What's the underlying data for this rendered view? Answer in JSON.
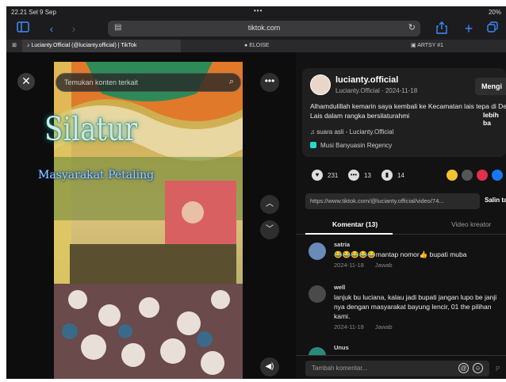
{
  "status": {
    "time": "22.21  Sel 9 Sep",
    "dots": "•••",
    "battery": "20%"
  },
  "browser": {
    "url": "tiktok.com"
  },
  "tabs": [
    {
      "label": "Lucianty.Official (@lucianty.official) | TikTok",
      "active": true
    },
    {
      "label": "ELOISE",
      "active": false
    },
    {
      "label": "ARTSY #1",
      "active": false
    }
  ],
  "video": {
    "search_placeholder": "Temukan konten terkait",
    "overlay_title": "Silatur",
    "overlay_subtitle": "Masyarakat Petaling"
  },
  "post": {
    "username": "lucianty.official",
    "meta": "Lucianty.Official · 2024-11-18",
    "follow_label": "Mengi",
    "caption": "Alhamdulillah kemarin saya kembali ke Kecamatan lais tepa di Desa Lais dalam rangka bersilaturahmi",
    "more_label": "lebih ba",
    "music": "suara asli - Lucianty.Official",
    "location": "Musi Banyuasin Regency",
    "likes": "231",
    "comments_count": "13",
    "saves": "14",
    "link": "https://www.tiktok.com/@lucianty.official/video/74...",
    "copy_link": "Salin tau"
  },
  "comment_tabs": {
    "comments": "Komentar (13)",
    "creator_videos": "Video kreator"
  },
  "comments": [
    {
      "name": "satria",
      "text": "😂😂😂😂😂mantap nomor👍 bupati muba",
      "date": "2024-11-18",
      "reply": "Jawab"
    },
    {
      "name": "well",
      "text": "lanjuk bu luciana, kalau jadi bupati jangan lupo be janji nya dengan masyarakat bayung lencir, 01 the pilihan kami.",
      "date": "2024-11-18",
      "reply": "Jawab"
    },
    {
      "name": "Unus",
      "text": "",
      "date": "",
      "reply": ""
    }
  ],
  "input": {
    "placeholder": "Tambah komentar...",
    "post_label": "P"
  },
  "colors": {
    "accent": "#3b8cff",
    "background": "#121212"
  }
}
